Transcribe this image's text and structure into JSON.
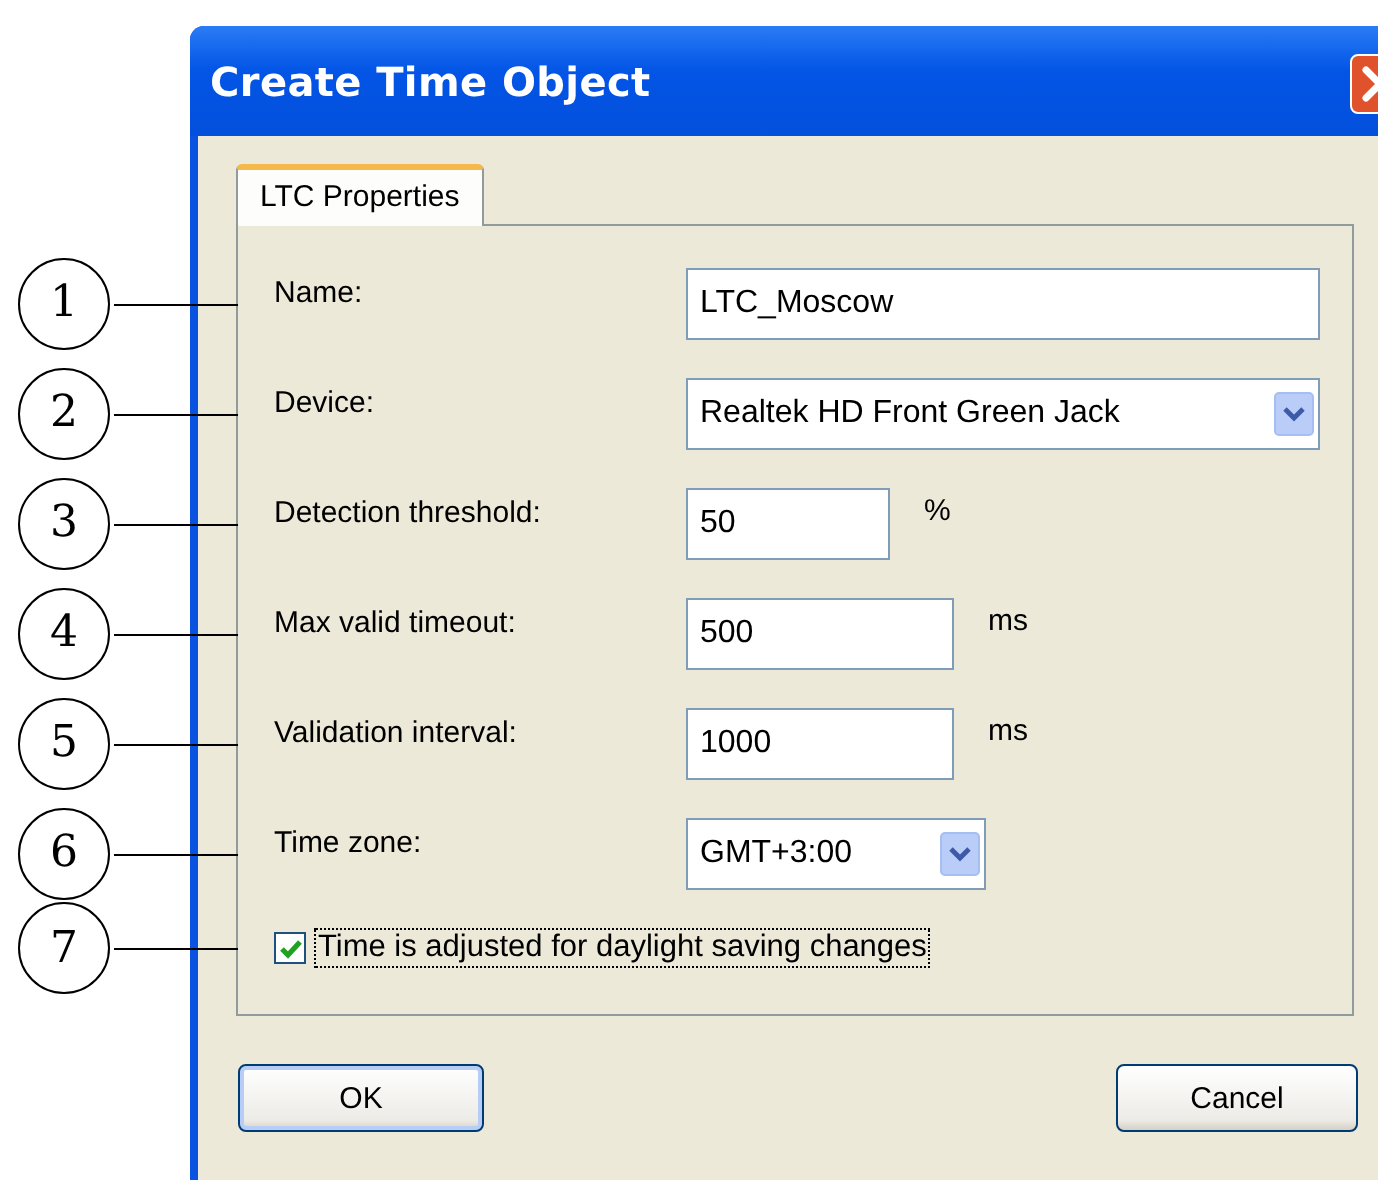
{
  "window": {
    "title": "Create Time Object"
  },
  "tabs": [
    {
      "label": "LTC Properties",
      "selected": true
    }
  ],
  "fields": [
    {
      "callout": "1",
      "kind": "text",
      "label": "Name:",
      "value": "LTC_Moscow"
    },
    {
      "callout": "2",
      "kind": "select",
      "label": "Device:",
      "value": "Realtek HD Front Green Jack"
    },
    {
      "callout": "3",
      "kind": "text",
      "label": "Detection threshold:",
      "value": "50",
      "unit": "%"
    },
    {
      "callout": "4",
      "kind": "text",
      "label": "Max valid timeout:",
      "value": "500",
      "unit": "ms"
    },
    {
      "callout": "5",
      "kind": "text",
      "label": "Validation interval:",
      "value": "1000",
      "unit": "ms"
    },
    {
      "callout": "6",
      "kind": "select",
      "label": "Time zone:",
      "value": "GMT+3:00"
    }
  ],
  "checkbox": {
    "callout": "7",
    "label": "Time is adjusted for daylight saving changes",
    "checked": true
  },
  "buttons": [
    "OK",
    "Cancel"
  ]
}
